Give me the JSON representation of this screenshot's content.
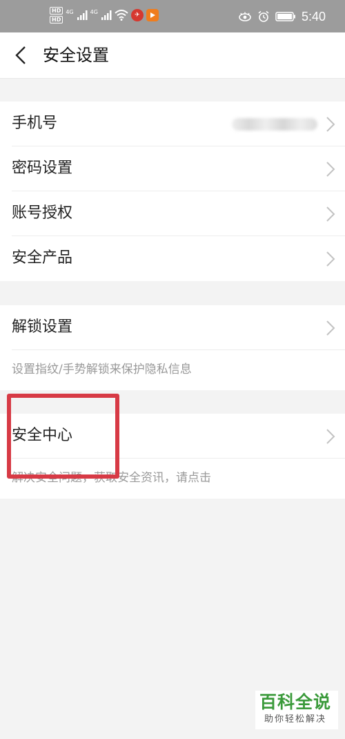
{
  "status_bar": {
    "hd_badge_1": "HD",
    "hd_badge_2": "HD",
    "network_1": "4G",
    "network_2": "4G",
    "time": "5:40"
  },
  "header": {
    "title": "安全设置"
  },
  "group1": {
    "items": [
      {
        "label": "手机号"
      },
      {
        "label": "密码设置"
      },
      {
        "label": "账号授权"
      },
      {
        "label": "安全产品"
      }
    ]
  },
  "group2": {
    "label": "解锁设置",
    "description": "设置指纹/手势解锁来保护隐私信息"
  },
  "group3": {
    "label": "安全中心",
    "description": "解决安全问题，获取安全资讯，请点击"
  },
  "watermark": {
    "title": "百科全说",
    "subtitle": "助你轻松解决"
  },
  "colors": {
    "status_bar_bg": "#9c9c9c",
    "page_bg": "#f3f3f3",
    "highlight_border": "#d73a45",
    "watermark_green": "#3a9a3a"
  }
}
